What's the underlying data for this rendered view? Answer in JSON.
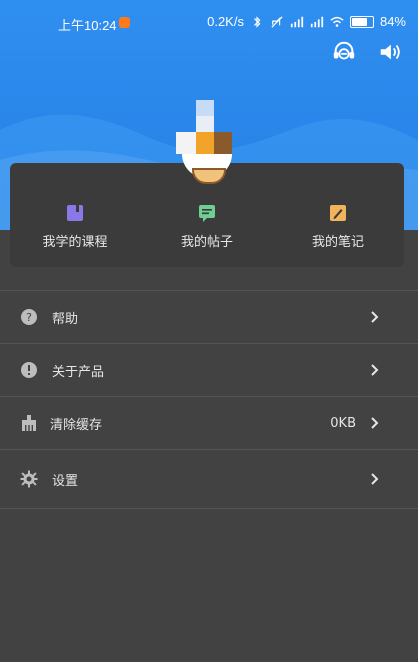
{
  "status_bar": {
    "time": "上午10:24",
    "network_speed": "0.2K/s",
    "battery_percent": "84%",
    "icons": [
      "bluetooth-icon",
      "mute-icon",
      "signal-icon",
      "signal-icon",
      "wifi-icon",
      "battery-icon"
    ]
  },
  "header": {
    "icons": [
      "headset-icon",
      "speaker-icon"
    ],
    "colors": {
      "background": "#2f8ff0",
      "wave": "#3f9bf2"
    }
  },
  "quick_actions": [
    {
      "label": "我学的课程",
      "icon": "book-icon",
      "color": "#8a78e8"
    },
    {
      "label": "我的帖子",
      "icon": "chat-icon",
      "color": "#6fce92"
    },
    {
      "label": "我的笔记",
      "icon": "note-icon",
      "color": "#f2b45a"
    }
  ],
  "menu": {
    "help": {
      "label": "帮助",
      "icon": "question-icon"
    },
    "about": {
      "label": "关于产品",
      "icon": "info-icon"
    },
    "clear_cache": {
      "label": "清除缓存",
      "icon": "broom-icon",
      "value": "0KB"
    },
    "settings": {
      "label": "设置",
      "icon": "gear-icon"
    }
  },
  "colors": {
    "page_bg": "#424242",
    "card_bg": "#3b3b3b",
    "text": "#e6e6e6"
  }
}
